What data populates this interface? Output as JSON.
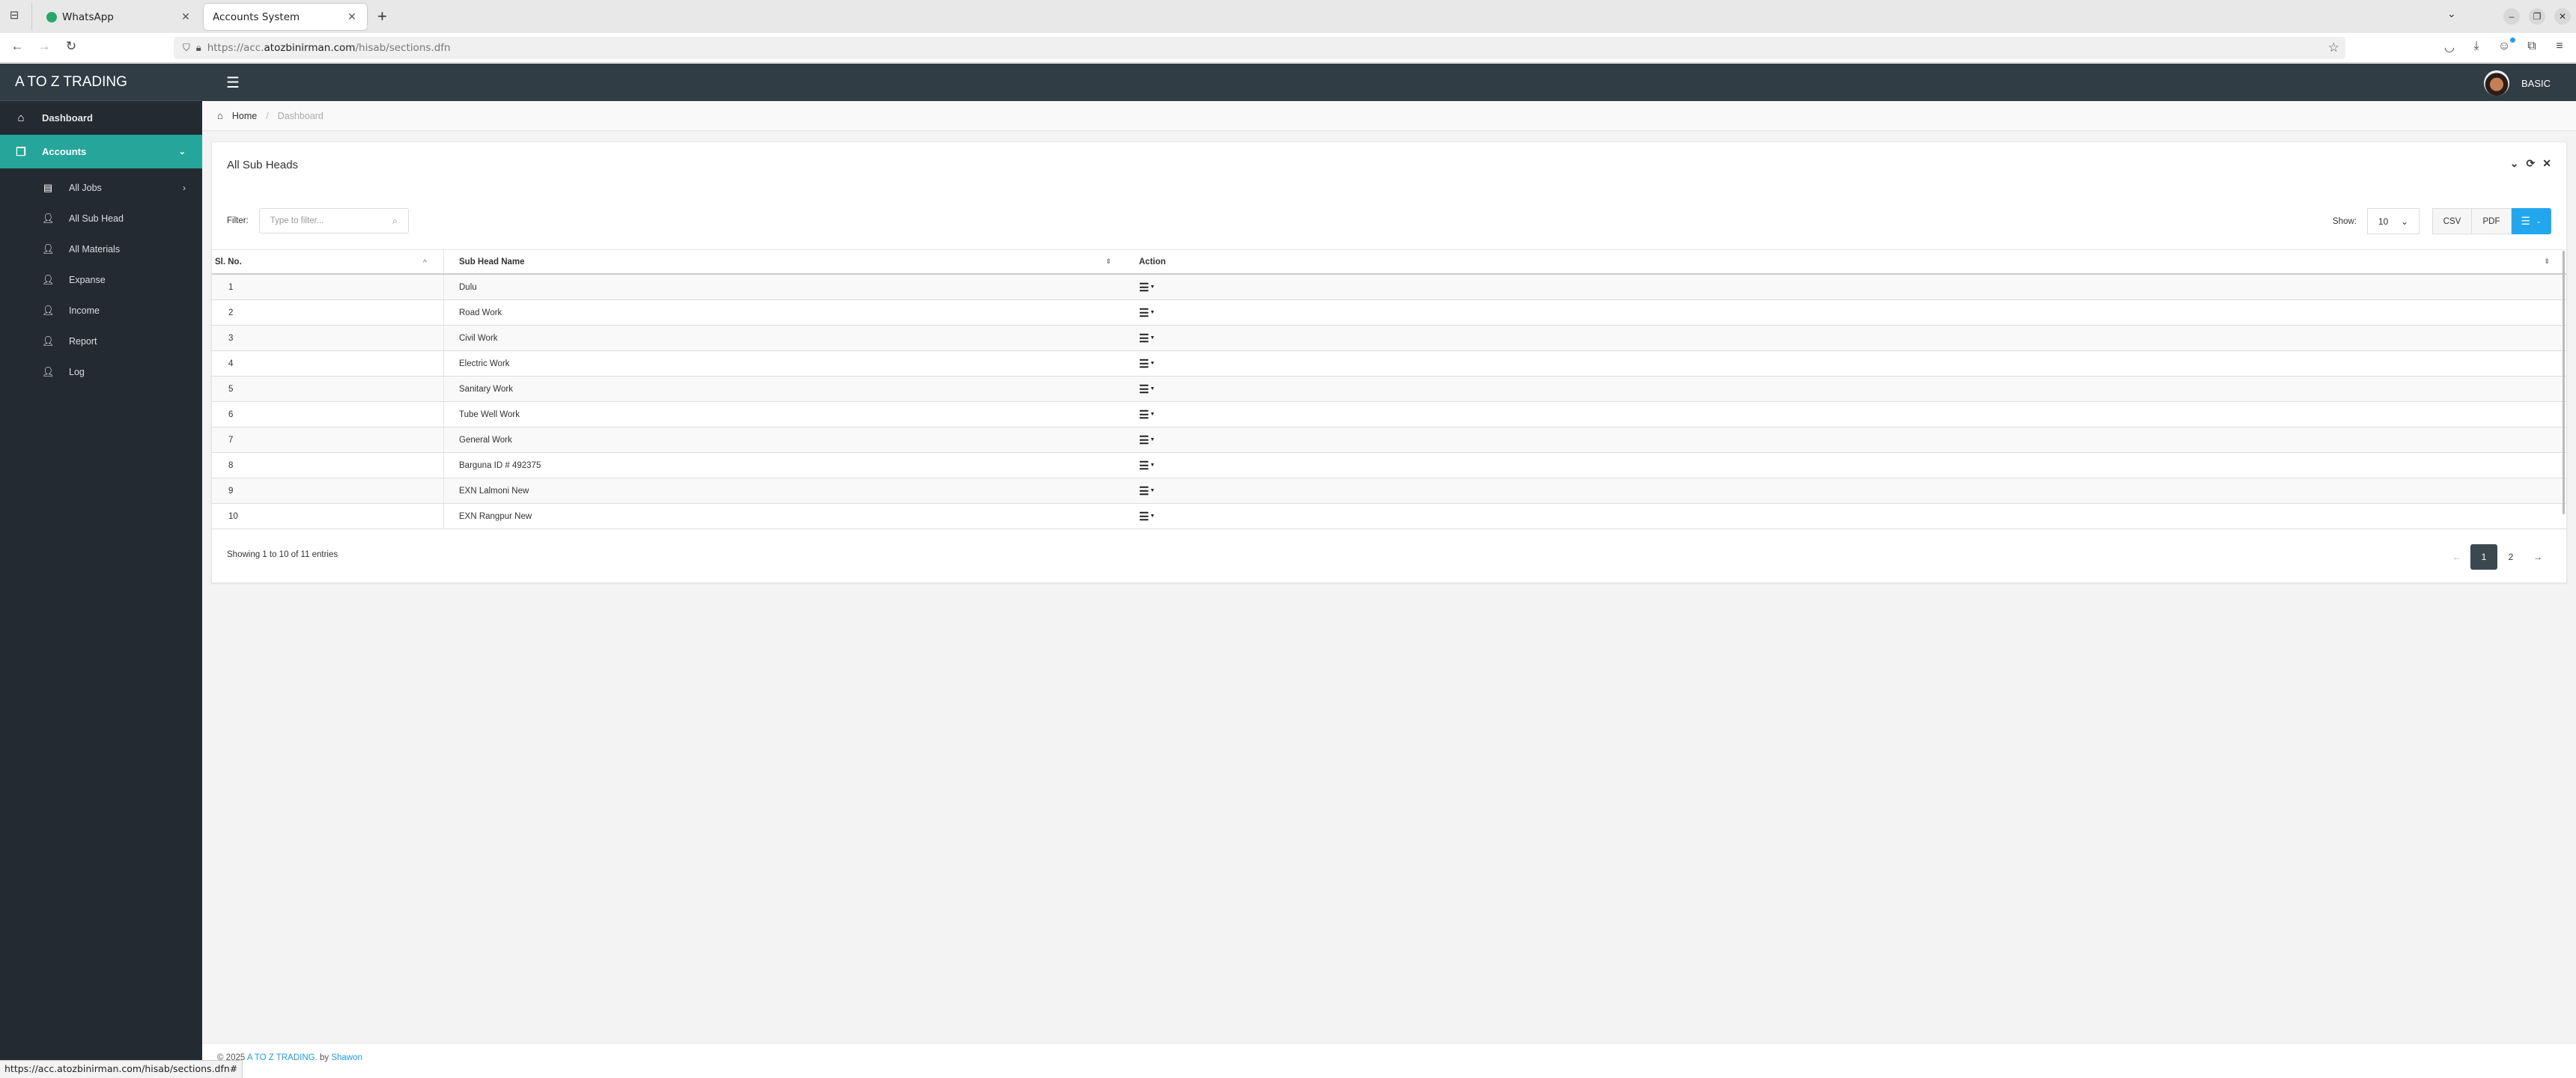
{
  "browser": {
    "tabs": [
      {
        "label": "WhatsApp",
        "active": false
      },
      {
        "label": "Accounts System",
        "active": true
      }
    ],
    "url_prefix": "https://acc.",
    "url_domain": "atozbinirman.com",
    "url_path": "/hisab/sections.dfn",
    "status_url": "https://acc.atozbinirman.com/hisab/sections.dfn#"
  },
  "header": {
    "brand": "A TO Z TRADING",
    "user_role": "BASIC"
  },
  "sidebar": {
    "items": [
      {
        "label": "Dashboard",
        "icon": "home-icon",
        "active": false
      },
      {
        "label": "Accounts",
        "icon": "copy-icon",
        "active": true
      }
    ],
    "subitems": [
      {
        "label": "All Jobs",
        "icon": "contact-book-icon",
        "has_arrow": true
      },
      {
        "label": "All Sub Head",
        "icon": "user-add-icon",
        "has_arrow": false
      },
      {
        "label": "All Materials",
        "icon": "user-add-icon",
        "has_arrow": false
      },
      {
        "label": "Expanse",
        "icon": "user-add-icon",
        "has_arrow": false
      },
      {
        "label": "Income",
        "icon": "user-add-icon",
        "has_arrow": false
      },
      {
        "label": "Report",
        "icon": "user-add-icon",
        "has_arrow": false
      },
      {
        "label": "Log",
        "icon": "user-add-icon",
        "has_arrow": false
      }
    ]
  },
  "breadcrumb": {
    "home": "Home",
    "separator": "/",
    "current": "Dashboard"
  },
  "panel": {
    "title": "All Sub Heads",
    "filter_label": "Filter:",
    "filter_placeholder": "Type to filter...",
    "filter_value": "",
    "show_label": "Show:",
    "show_value": "10",
    "csv_label": "CSV",
    "pdf_label": "PDF"
  },
  "table": {
    "columns": [
      "Sl. No.",
      "Sub Head Name",
      "Action"
    ],
    "rows": [
      {
        "sl": "1",
        "name": "Dulu"
      },
      {
        "sl": "2",
        "name": "Road Work"
      },
      {
        "sl": "3",
        "name": "Civil Work"
      },
      {
        "sl": "4",
        "name": "Electric Work"
      },
      {
        "sl": "5",
        "name": "Sanitary Work"
      },
      {
        "sl": "6",
        "name": "Tube Well Work"
      },
      {
        "sl": "7",
        "name": "General Work"
      },
      {
        "sl": "8",
        "name": "Barguna ID # 492375"
      },
      {
        "sl": "9",
        "name": "EXN Lalmoni New"
      },
      {
        "sl": "10",
        "name": "EXN Rangpur New"
      }
    ],
    "info": "Showing 1 to 10 of 11 entries"
  },
  "pagination": {
    "prev": "←",
    "pages": [
      "1",
      "2"
    ],
    "current": "1",
    "next": "→"
  },
  "footer": {
    "copyright": "© 2025",
    "company": "A TO Z TRADING.",
    "by": "by",
    "author": "Shawon"
  },
  "colors": {
    "accent": "#26a69a",
    "header_bg": "#313d45",
    "sidebar_bg": "#232b31",
    "primary_button": "#22a7ee",
    "link": "#1e9be0"
  }
}
